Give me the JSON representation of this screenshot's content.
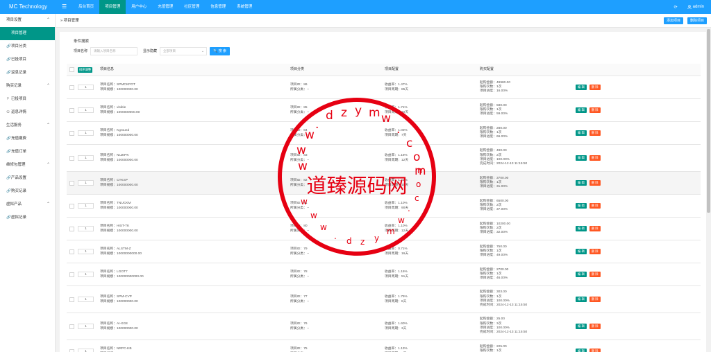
{
  "brand": "MC Technology",
  "top_nav": {
    "menu_toggle": "☰",
    "items": [
      {
        "label": "后台首页",
        "active": false
      },
      {
        "label": "项目管理",
        "active": true
      },
      {
        "label": "用户中心",
        "active": false
      },
      {
        "label": "充值管理",
        "active": false
      },
      {
        "label": "社区管理",
        "active": false
      },
      {
        "label": "信息管理",
        "active": false
      },
      {
        "label": "系统管理",
        "active": false
      }
    ],
    "refresh_icon": "⟳",
    "user_icon": "user-icon",
    "user": "admin"
  },
  "sidebar": {
    "items": [
      {
        "type": "group",
        "label": "项目设置"
      },
      {
        "type": "item",
        "label": "项目管理",
        "active": true,
        "icon": ""
      },
      {
        "type": "item",
        "label": "项目分类",
        "icon": "🔗"
      },
      {
        "type": "item",
        "label": "已投项目",
        "icon": "🔗"
      },
      {
        "type": "item",
        "label": "返息记录",
        "icon": "🔗"
      },
      {
        "type": "group",
        "label": "购买记录"
      },
      {
        "type": "item",
        "label": "已投项目",
        "icon": "⚐"
      },
      {
        "type": "item",
        "label": "返息详情",
        "icon": "①"
      },
      {
        "type": "group",
        "label": "生活服务"
      },
      {
        "type": "item",
        "label": "充值缴费",
        "icon": "🔗"
      },
      {
        "type": "item",
        "label": "充值订单",
        "icon": "🔗"
      },
      {
        "type": "group",
        "label": "维修包管理"
      },
      {
        "type": "item",
        "label": "产品设置",
        "icon": "🔗"
      },
      {
        "type": "item",
        "label": "购买记录",
        "icon": "🔗"
      },
      {
        "type": "group",
        "label": "虚拟产品"
      },
      {
        "type": "item",
        "label": "虚拟记录",
        "icon": "🔗"
      }
    ]
  },
  "breadcrumb": "» 项目管理",
  "actions": {
    "add": "添加项目",
    "delete": "删除项目"
  },
  "search": {
    "title": "条件搜索",
    "name_label": "项目名称",
    "name_placeholder": "请输入项目名称",
    "show_label": "显示隐藏",
    "show_value": "全部项目",
    "button": "🔍 搜 索"
  },
  "table": {
    "headers": {
      "sort": "排序调整",
      "info": "项目信息",
      "category": "项目分类",
      "config": "项目配置",
      "purchase": "购买配置"
    },
    "edit_label": "编 辑",
    "delete_label": "删 除",
    "rows": [
      {
        "sort": "1",
        "name": "项目名称：SPMCKPOT",
        "scale": "项目规模：100000000.00",
        "id": "项目ID：86",
        "category": "所属分类：--",
        "rate": "收益率：1.47%",
        "cycle": "项目周期：85天",
        "buy": [
          "起购金额：49980.00",
          "限购次数：1次",
          "项目进度：16.00%"
        ]
      },
      {
        "sort": "1",
        "name": "项目名称：visible",
        "scale": "项目规模：1000000000.00",
        "id": "项目ID：85",
        "category": "所属分类：--",
        "rate": "收益率：1.71%",
        "cycle": "项目周期：10天",
        "buy": [
          "起购金额：580.00",
          "限购次数：1次",
          "项目进度：59.00%"
        ]
      },
      {
        "sort": "1",
        "name": "项目名称：Kground",
        "scale": "项目规模：100000000.00",
        "id": "项目ID：84",
        "category": "所属分类：--",
        "rate": "收益率：1.03%",
        "cycle": "项目周期：7天",
        "buy": [
          "起购金额：280.00",
          "限购次数：1次",
          "项目进度：66.00%"
        ]
      },
      {
        "sort": "1",
        "name": "项目名称：NUZIPK",
        "scale": "项目规模：100000000.00",
        "id": "项目ID：83",
        "category": "所属分类：--",
        "rate": "收益率：1.18%",
        "cycle": "项目周期：12天",
        "buy": [
          "起购金额：490.00",
          "限购次数：2次",
          "项目进度：100.00%",
          "完成时间：2024-12-13 11:15:50"
        ]
      },
      {
        "sort": "1",
        "name": "项目名称：CTKSP",
        "scale": "项目规模：100000000.00",
        "id": "项目ID：82",
        "category": "所属分类：--",
        "rate": "收益率：1.21%",
        "cycle": "项目周期：15天",
        "buy": [
          "起购金额：3700.00",
          "限购次数：1次",
          "项目进度：31.00%"
        ]
      },
      {
        "sort": "1",
        "name": "项目名称：TNUCKM",
        "scale": "项目规模：100000000.00",
        "id": "项目ID：81",
        "category": "所属分类：--",
        "rate": "收益率：1.10%",
        "cycle": "项目周期：90天",
        "buy": [
          "起购金额：6500.00",
          "限购次数：2次",
          "项目进度：37.00%"
        ]
      },
      {
        "sort": "1",
        "name": "项目名称：HIST-TK",
        "scale": "项目规模：100000000.00",
        "id": "项目ID：80",
        "category": "所属分类：--",
        "rate": "收益率：1.10%",
        "cycle": "项目周期：12天",
        "buy": [
          "起购金额：10200.00",
          "限购次数：2次",
          "项目进度：32.00%"
        ]
      },
      {
        "sort": "1",
        "name": "项目名称：ALSTM-Z",
        "scale": "项目规模：10000000000.00",
        "id": "项目ID：79",
        "category": "所属分类：--",
        "rate": "收益率：0.71%",
        "cycle": "项目周期：16天",
        "buy": [
          "起购金额：750.00",
          "限购次数：1次",
          "项目进度：49.00%"
        ]
      },
      {
        "sort": "1",
        "name": "项目名称：LGOT7",
        "scale": "项目规模：100000000000.00",
        "id": "项目ID：78",
        "category": "所属分类：--",
        "rate": "收益率：1.15%",
        "cycle": "项目周期：51天",
        "buy": [
          "起购金额：2700.00",
          "限购次数：1次",
          "项目进度：46.00%"
        ]
      },
      {
        "sort": "1",
        "name": "项目名称：SPM-CVP",
        "scale": "项目规模：100000000.00",
        "id": "项目ID：77",
        "category": "所属分类：--",
        "rate": "收益率：1.75%",
        "cycle": "项目周期：8天",
        "buy": [
          "起购金额：303.00",
          "限购次数：1次",
          "项目进度：100.00%",
          "完成时间：2024-12-13 11:15:50"
        ]
      },
      {
        "sort": "1",
        "name": "项目名称：AI-XG8",
        "scale": "项目规模：100000000.00",
        "id": "项目ID：76",
        "category": "所属分类：--",
        "rate": "收益率：1.60%",
        "cycle": "项目周期：3天",
        "buy": [
          "起购金额：25.00",
          "限购次数：3次",
          "项目进度：100.00%",
          "完成时间：2024-12-13 11:15:50"
        ]
      },
      {
        "sort": "1",
        "name": "项目名称：NRPC-KB",
        "scale": "项目规模：100000000.00",
        "id": "项目ID：75",
        "category": "所属分类：--",
        "rate": "收益率：1.13%",
        "cycle": "项目周期：6天",
        "buy": [
          "起购金额：225.00",
          "限购次数：1次",
          "项目进度：79.00%"
        ]
      }
    ]
  },
  "watermark": {
    "text": "道臻源码网",
    "color": "#e60012",
    "url_letters": "w w w . d z y m w . c o m"
  }
}
